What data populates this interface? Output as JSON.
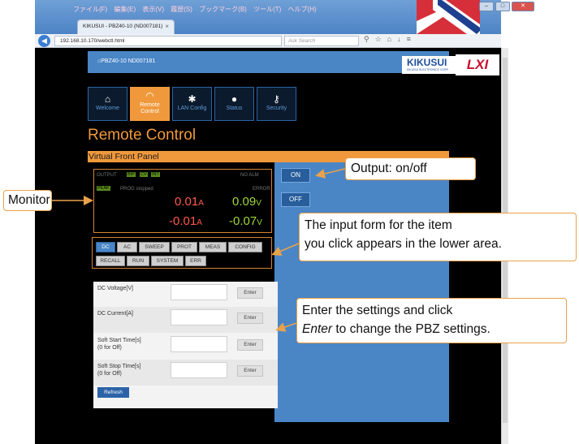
{
  "browser": {
    "menu": [
      "ファイル(F)",
      "編集(E)",
      "表示(V)",
      "履歴(S)",
      "ブックマーク(B)",
      "ツール(T)",
      "ヘルプ(H)"
    ],
    "tab_title": "KIKUSUI - PBZ40-10 (ND007181)",
    "url": "192.168.10.170/webctl.html",
    "search_placeholder": "Ask Search",
    "colors": {
      "chrome": "#4d83c5",
      "flag_red": "#d62f3a"
    }
  },
  "page": {
    "header_title": "PBZ40-10 ND007181",
    "logo_text": "KIKUSUI",
    "logo_sub": "KIKUSUI ELECTRONICS CORP.",
    "lxi_text": "LXI",
    "nav_tabs": [
      {
        "label": "Welcome",
        "icon": "home-icon"
      },
      {
        "label": "Remote Control",
        "icon": "gauge-icon",
        "active": true
      },
      {
        "label": "LAN Config",
        "icon": "gear-icon"
      },
      {
        "label": "Status",
        "icon": "info-icon"
      },
      {
        "label": "Security",
        "icon": "key-icon"
      }
    ],
    "title": "Remote Control",
    "section_title": "Virtual Front Panel",
    "colors": {
      "accent": "#f0993c",
      "blue": "#4a86c6",
      "panel_border": "#d68331"
    }
  },
  "monitor": {
    "output_label": "OUTPUT",
    "lamps": [
      "BIP",
      "CV",
      "INT",
      "PEAK"
    ],
    "prog_status": "PROG stopped",
    "alarm": "NO ALM",
    "error": "ERROR",
    "current_1": "0.01",
    "current_unit": "A",
    "voltage_1": "0.09",
    "voltage_unit": "V",
    "current_2": "-0.01",
    "voltage_2": "-0.07"
  },
  "output_buttons": {
    "on": "ON",
    "off": "OFF"
  },
  "function_buttons": {
    "row1": [
      "DC",
      "AC",
      "SWEEP",
      "PROT",
      "MEAS",
      "CONFIG"
    ],
    "row2": [
      "RECALL",
      "RUN",
      "SYSTEM",
      "ERR"
    ]
  },
  "form": {
    "rows": [
      {
        "label_1": "DC Voltage[V]",
        "label_2": "",
        "enter": "Enter"
      },
      {
        "label_1": "DC Current[A]",
        "label_2": "",
        "enter": "Enter"
      },
      {
        "label_1": "Soft Start Time[s]",
        "label_2": "(0 for Off)",
        "enter": "Enter"
      },
      {
        "label_1": "Soft Stop Time[s]",
        "label_2": "(0 for Off)",
        "enter": "Enter"
      }
    ],
    "refresh": "Refresh"
  },
  "callouts": {
    "output": "Output: on/off",
    "monitor": "Monitor",
    "input_form_1": "The input form for the item",
    "input_form_2": "you click appears in the lower area.",
    "enter_1": "Enter the settings and click",
    "enter_2_em": "Enter",
    "enter_2_rest": " to change the PBZ settings."
  }
}
